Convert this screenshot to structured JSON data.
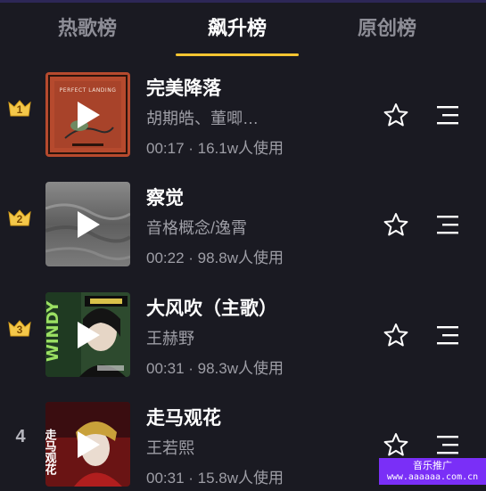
{
  "tabs": [
    {
      "label": "热歌榜",
      "active": false
    },
    {
      "label": "飙升榜",
      "active": true
    },
    {
      "label": "原创榜",
      "active": false
    }
  ],
  "accent_color": "#f5c531",
  "songs": [
    {
      "rank": "1",
      "rank_icon": "gold-crown-icon",
      "cover_text": "PERFECT LANDING",
      "title": "完美降落",
      "artist": "胡期皓、董唧…",
      "meta": "00:17 · 16.1w人使用"
    },
    {
      "rank": "2",
      "rank_icon": "gold-crown-icon",
      "title": "察觉",
      "artist": "音格概念/逸霄",
      "meta": "00:22 · 98.8w人使用"
    },
    {
      "rank": "3",
      "rank_icon": "gold-crown-icon",
      "cover_text": "WINDY",
      "title": "大风吹（主歌）",
      "artist": "王赫野",
      "meta": "00:31 · 98.3w人使用"
    },
    {
      "rank": "4",
      "rank_icon": "",
      "cover_text": "走马观花",
      "title": "走马观花",
      "artist": "王若熙",
      "meta": "00:31 · 15.8w人使用"
    }
  ],
  "watermark": {
    "line1": "音乐推广",
    "line2": "www.aaaaaa.com.cn"
  }
}
